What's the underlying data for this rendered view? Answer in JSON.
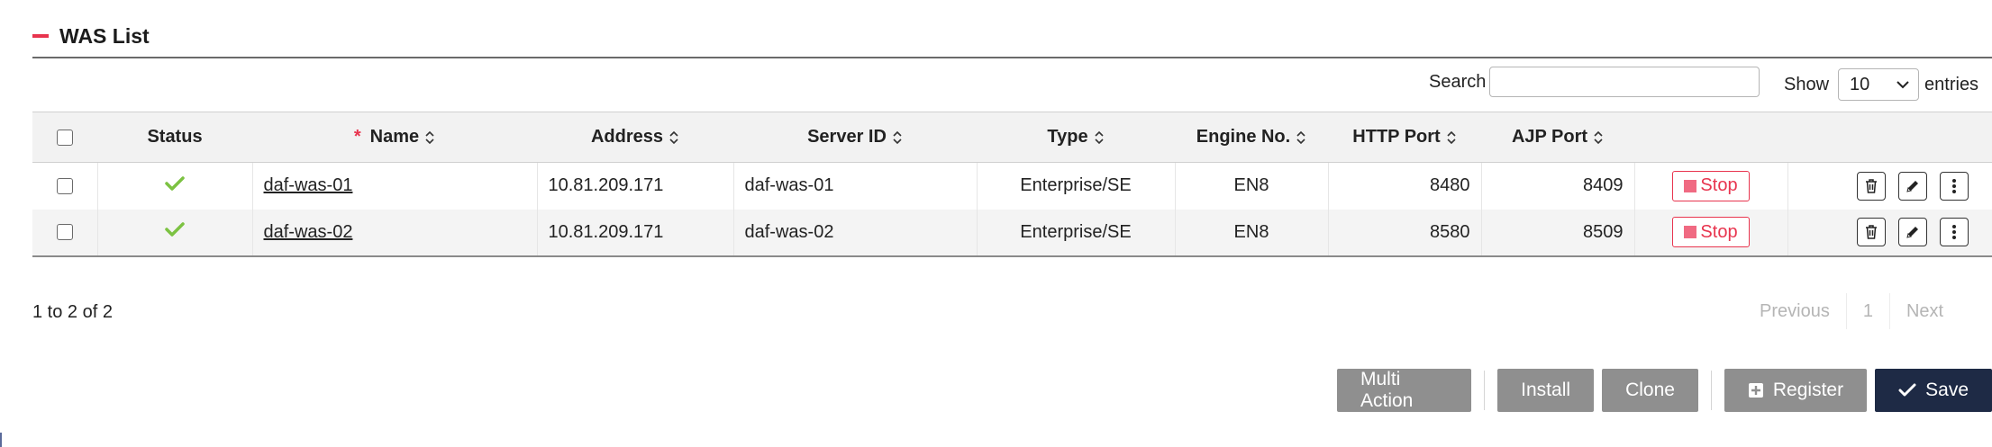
{
  "section": {
    "title": "WAS List"
  },
  "search": {
    "label": "Search",
    "value": "",
    "placeholder": ""
  },
  "page_length": {
    "label_before": "Show",
    "selected": "10",
    "label_after": "entries"
  },
  "table": {
    "headers": {
      "status": "Status",
      "name_required": "*",
      "name": "Name",
      "address": "Address",
      "server_id": "Server ID",
      "type": "Type",
      "engine_no": "Engine No.",
      "http_port": "HTTP Port",
      "ajp_port": "AJP Port"
    },
    "stop_label": "Stop",
    "rows": [
      {
        "name": "daf-was-01",
        "address": "10.81.209.171",
        "server_id": "daf-was-01",
        "type": "Enterprise/SE",
        "engine_no": "EN8",
        "http_port": "8480",
        "ajp_port": "8409",
        "status": "check-icon"
      },
      {
        "name": "daf-was-02",
        "address": "10.81.209.171",
        "server_id": "daf-was-02",
        "type": "Enterprise/SE",
        "engine_no": "EN8",
        "http_port": "8580",
        "ajp_port": "8509",
        "status": "check-icon"
      }
    ]
  },
  "info": {
    "text": "1 to 2 of 2"
  },
  "pagination": {
    "previous": "Previous",
    "page": "1",
    "next": "Next"
  },
  "buttons": {
    "multi_action": "Multi Action",
    "install": "Install",
    "clone": "Clone",
    "register": "Register",
    "save": "Save"
  },
  "colors": {
    "accent_red": "#e8344e",
    "check_green": "#7cc242",
    "button_gray": "#8f8f8f",
    "save_navy": "#1e2a45"
  }
}
